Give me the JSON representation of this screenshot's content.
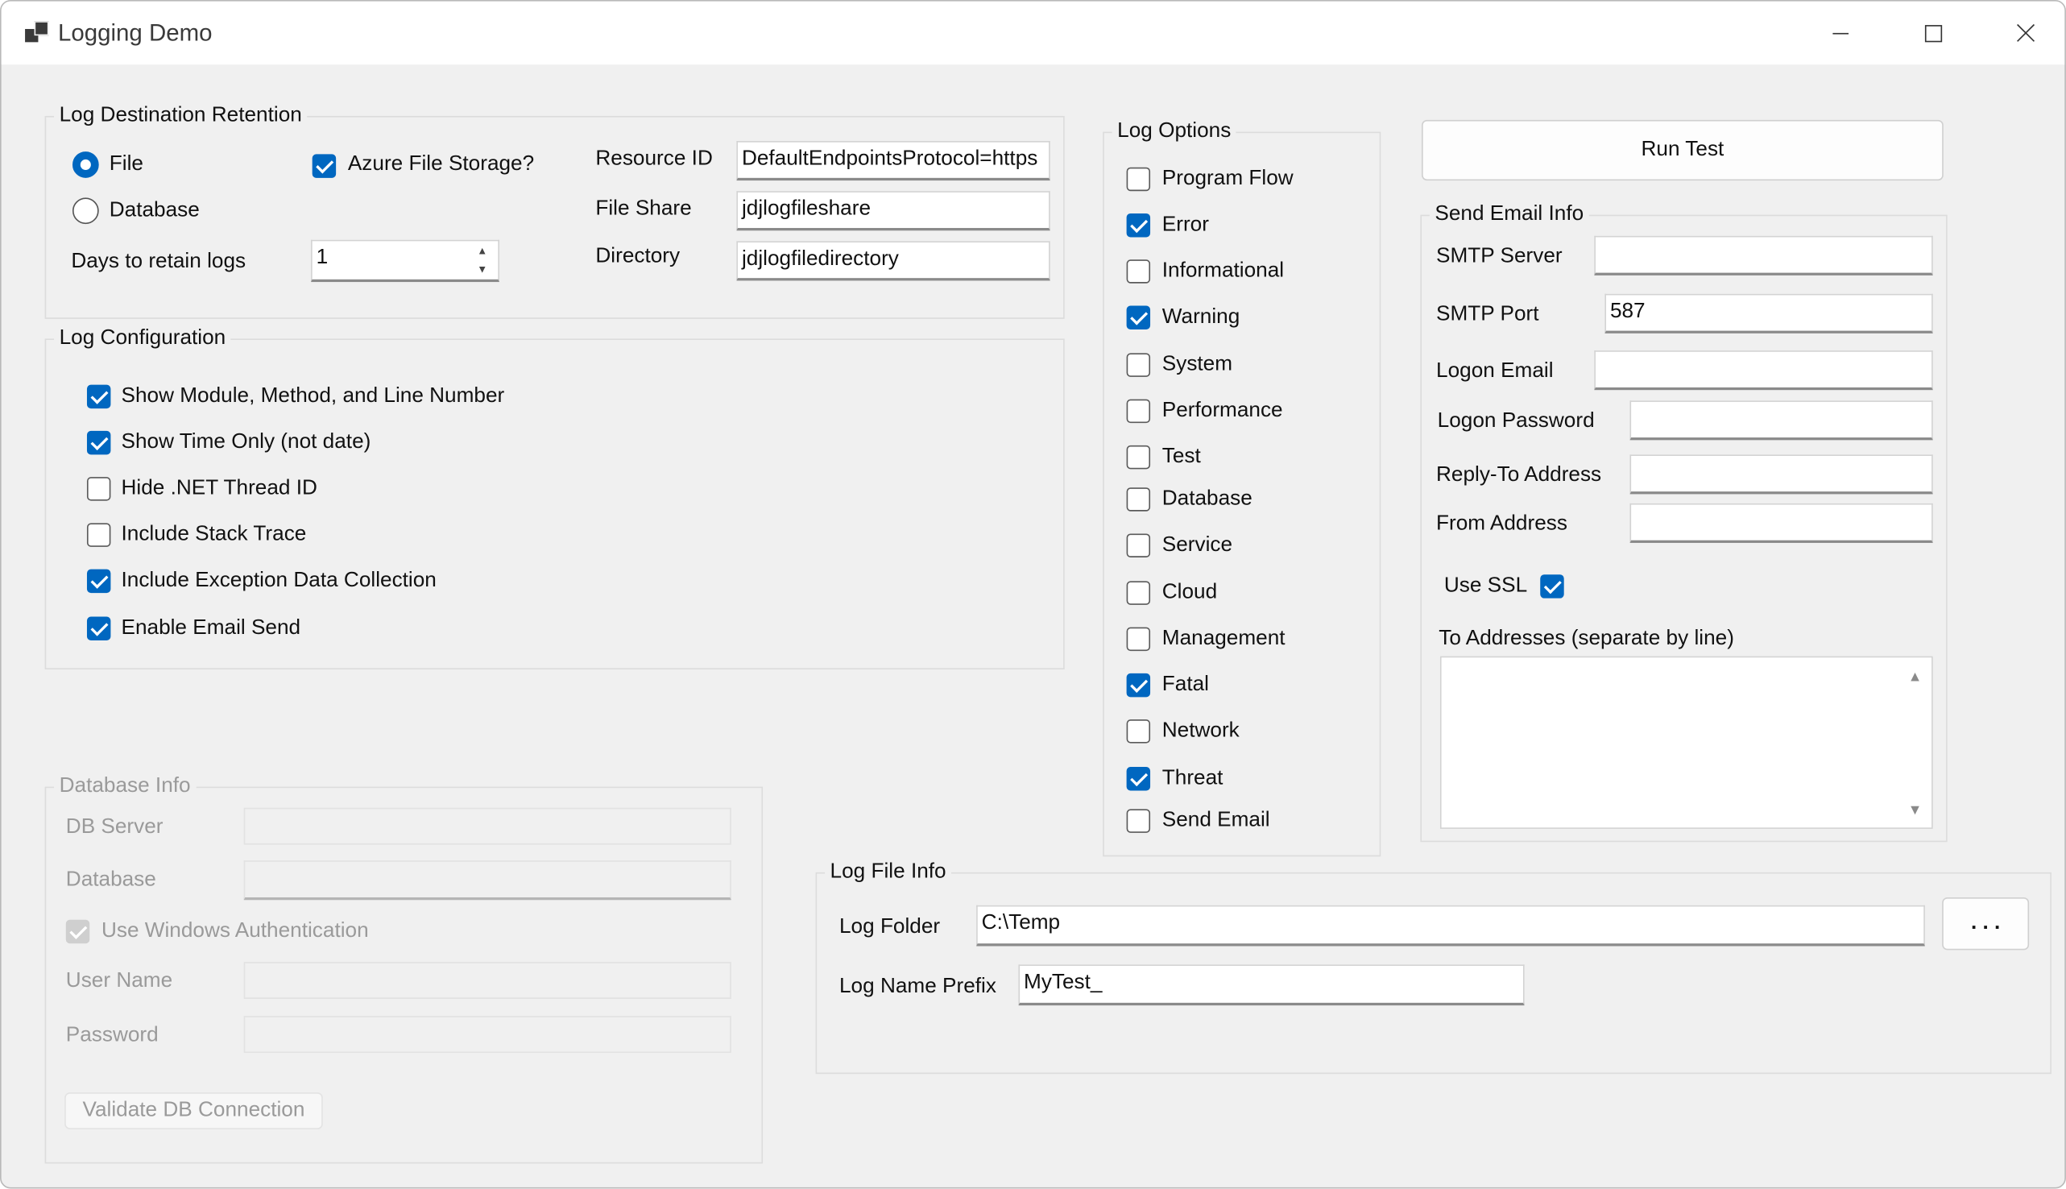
{
  "window": {
    "title": "Logging Demo"
  },
  "log_destination": {
    "legend": "Log Destination  Retention",
    "file_label": "File",
    "file_selected": true,
    "database_label": "Database",
    "database_selected": false,
    "azure_label": "Azure File Storage?",
    "azure_checked": true,
    "days_label": "Days to retain logs",
    "days_value": "1",
    "resource_id_label": "Resource ID",
    "resource_id_value": "DefaultEndpointsProtocol=https",
    "file_share_label": "File Share",
    "file_share_value": "jdjlogfileshare",
    "directory_label": "Directory",
    "directory_value": "jdjlogfiledirectory"
  },
  "log_configuration": {
    "legend": "Log Configuration",
    "items": [
      {
        "label": "Show Module, Method, and Line Number",
        "checked": true
      },
      {
        "label": "Show Time Only (not date)",
        "checked": true
      },
      {
        "label": "Hide .NET Thread ID",
        "checked": false
      },
      {
        "label": "Include Stack Trace",
        "checked": false
      },
      {
        "label": "Include Exception Data Collection",
        "checked": true
      },
      {
        "label": "Enable Email Send",
        "checked": true
      }
    ]
  },
  "database_info": {
    "legend": "Database Info",
    "db_server_label": "DB Server",
    "database_label": "Database",
    "windows_auth_label": "Use Windows Authentication",
    "windows_auth_checked": true,
    "user_name_label": "User Name",
    "password_label": "Password",
    "validate_button": "Validate DB Connection"
  },
  "log_options": {
    "legend": "Log Options",
    "items": [
      {
        "label": "Program Flow",
        "checked": false
      },
      {
        "label": "Error",
        "checked": true
      },
      {
        "label": "Informational",
        "checked": false
      },
      {
        "label": "Warning",
        "checked": true
      },
      {
        "label": "System",
        "checked": false
      },
      {
        "label": "Performance",
        "checked": false
      },
      {
        "label": "Test",
        "checked": false
      },
      {
        "label": "Database",
        "checked": false
      },
      {
        "label": "Service",
        "checked": false
      },
      {
        "label": "Cloud",
        "checked": false
      },
      {
        "label": "Management",
        "checked": false
      },
      {
        "label": "Fatal",
        "checked": true
      },
      {
        "label": "Network",
        "checked": false
      },
      {
        "label": "Threat",
        "checked": true
      },
      {
        "label": "Send Email",
        "checked": false
      }
    ]
  },
  "run_test_button": "Run Test",
  "send_email_info": {
    "legend": "Send Email Info",
    "smtp_server_label": "SMTP Server",
    "smtp_server_value": "",
    "smtp_port_label": "SMTP Port",
    "smtp_port_value": "587",
    "logon_email_label": "Logon Email",
    "logon_email_value": "",
    "logon_password_label": "Logon Password",
    "logon_password_value": "",
    "reply_to_label": "Reply-To Address",
    "reply_to_value": "",
    "from_label": "From Address",
    "from_value": "",
    "use_ssl_label": "Use SSL",
    "use_ssl_checked": true,
    "to_addresses_label": "To Addresses (separate by line)",
    "to_addresses_value": ""
  },
  "log_file_info": {
    "legend": "Log File Info",
    "folder_label": "Log Folder",
    "folder_value": "C:\\Temp",
    "browse_button": ". . .",
    "prefix_label": "Log Name Prefix",
    "prefix_value": "MyTest_"
  },
  "colors": {
    "accent": "#0067c0",
    "window_bg": "#f0f0f0",
    "title_bg": "#ffffff"
  }
}
